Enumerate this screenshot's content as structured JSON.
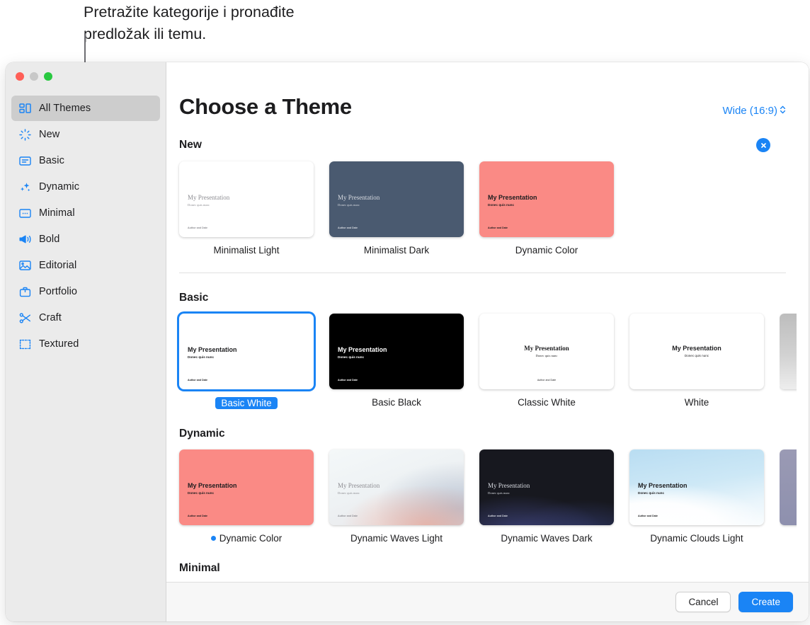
{
  "callout": {
    "text": "Pretražite kategorije i pronađite\npredložak ili temu."
  },
  "window": {
    "traffic_lights": [
      "close",
      "minimize",
      "zoom"
    ]
  },
  "sidebar": {
    "items": [
      {
        "label": "All Themes",
        "icon": "grid-layout-icon",
        "selected": true
      },
      {
        "label": "New",
        "icon": "sparkle-burst-icon",
        "selected": false
      },
      {
        "label": "Basic",
        "icon": "rectangle-lines-icon",
        "selected": false
      },
      {
        "label": "Dynamic",
        "icon": "sparkles-icon",
        "selected": false
      },
      {
        "label": "Minimal",
        "icon": "rectangle-dots-icon",
        "selected": false
      },
      {
        "label": "Bold",
        "icon": "megaphone-icon",
        "selected": false
      },
      {
        "label": "Editorial",
        "icon": "photo-icon",
        "selected": false
      },
      {
        "label": "Portfolio",
        "icon": "briefcase-icon",
        "selected": false
      },
      {
        "label": "Craft",
        "icon": "scissors-icon",
        "selected": false
      },
      {
        "label": "Textured",
        "icon": "dashed-frame-icon",
        "selected": false
      }
    ]
  },
  "header": {
    "title": "Choose a Theme",
    "aspect_ratio": "Wide (16:9)",
    "aspect_ratio_chevron": "⌃⌄"
  },
  "thumbnail_text": {
    "title": "My Presentation",
    "subtitle": "Donec quis nunc",
    "author": "Author and Date"
  },
  "sections": [
    {
      "title": "New",
      "has_close_badge": true,
      "themes": [
        {
          "name": "Minimalist Light",
          "selected": false,
          "dot": false
        },
        {
          "name": "Minimalist Dark",
          "selected": false,
          "dot": false
        },
        {
          "name": "Dynamic Color",
          "selected": false,
          "dot": false
        }
      ]
    },
    {
      "title": "Basic",
      "has_close_badge": false,
      "themes": [
        {
          "name": "Basic White",
          "selected": true,
          "dot": false
        },
        {
          "name": "Basic Black",
          "selected": false,
          "dot": false
        },
        {
          "name": "Classic White",
          "selected": false,
          "dot": false
        },
        {
          "name": "White",
          "selected": false,
          "dot": false
        }
      ]
    },
    {
      "title": "Dynamic",
      "has_close_badge": false,
      "themes": [
        {
          "name": "Dynamic Color",
          "selected": false,
          "dot": true
        },
        {
          "name": "Dynamic Waves Light",
          "selected": false,
          "dot": false
        },
        {
          "name": "Dynamic Waves Dark",
          "selected": false,
          "dot": false
        },
        {
          "name": "Dynamic Clouds Light",
          "selected": false,
          "dot": false
        }
      ]
    },
    {
      "title": "Minimal",
      "has_close_badge": false,
      "themes": []
    }
  ],
  "footer": {
    "cancel_label": "Cancel",
    "create_label": "Create"
  },
  "colors": {
    "accent": "#1a84f5",
    "sidebar_bg": "#ebebeb",
    "selected_item_bg": "#cdcdcd",
    "coral": "#fa8a85",
    "navy": "#4a5a70"
  }
}
